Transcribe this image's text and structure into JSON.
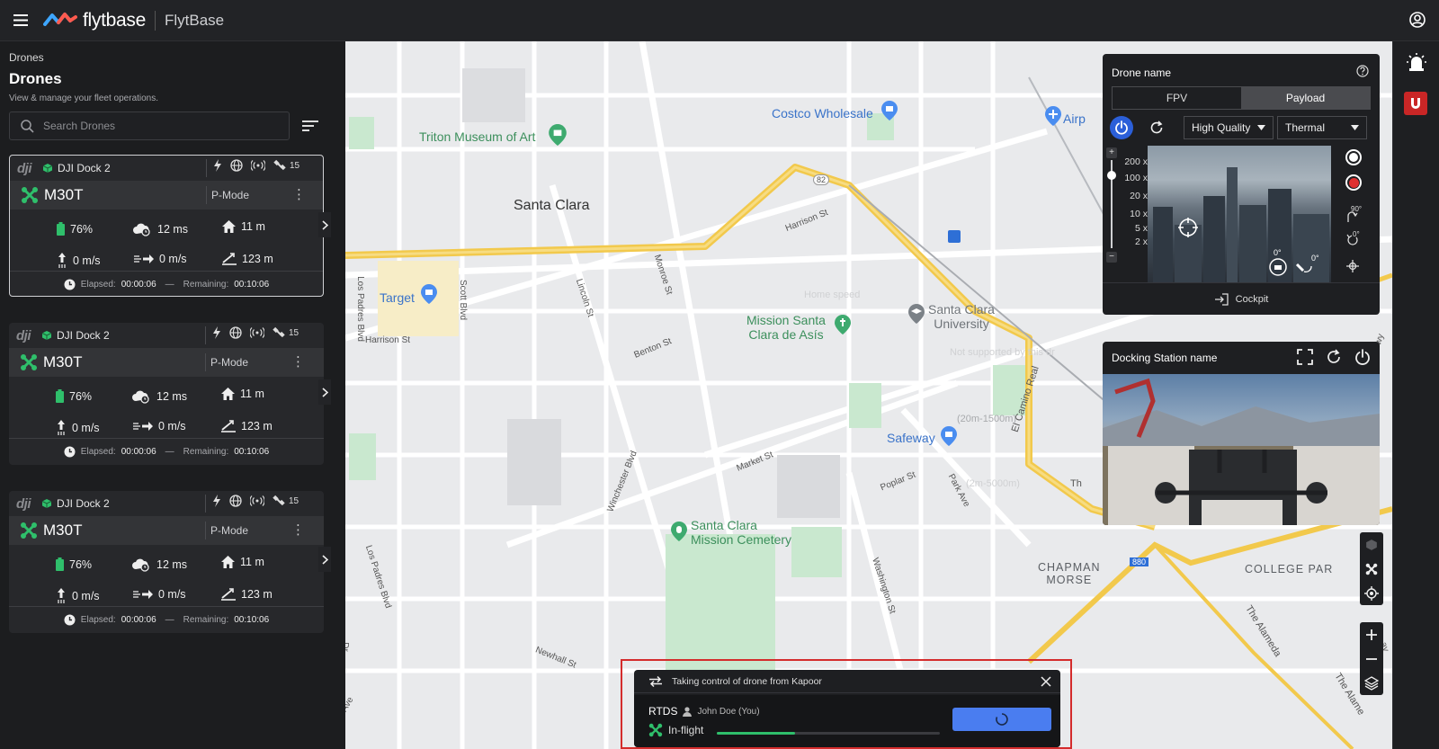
{
  "app": {
    "brand": "flytbase",
    "org": "FlytBase"
  },
  "sidebar": {
    "breadcrumb": "Drones",
    "title": "Drones",
    "subtitle": "View & manage your fleet operations.",
    "search_placeholder": "Search Drones"
  },
  "drones": [
    {
      "brand": "dji",
      "dock": "DJI Dock 2",
      "satellites": "15",
      "model": "M30T",
      "mode": "P-Mode",
      "battery": "76%",
      "latency": "12 ms",
      "home_distance": "11 m",
      "vspeed": "0 m/s",
      "hspeed": "0 m/s",
      "altitude": "123 m",
      "elapsed_label": "Elapsed:",
      "elapsed": "00:00:06",
      "sep": "—",
      "remaining_label": "Remaining:",
      "remaining": "00:10:06"
    },
    {
      "brand": "dji",
      "dock": "DJI Dock 2",
      "satellites": "15",
      "model": "M30T",
      "mode": "P-Mode",
      "battery": "76%",
      "latency": "12 ms",
      "home_distance": "11 m",
      "vspeed": "0 m/s",
      "hspeed": "0 m/s",
      "altitude": "123 m",
      "elapsed_label": "Elapsed:",
      "elapsed": "00:00:06",
      "sep": "—",
      "remaining_label": "Remaining:",
      "remaining": "00:10:06"
    },
    {
      "brand": "dji",
      "dock": "DJI Dock 2",
      "satellites": "15",
      "model": "M30T",
      "mode": "P-Mode",
      "battery": "76%",
      "latency": "12 ms",
      "home_distance": "11 m",
      "vspeed": "0 m/s",
      "hspeed": "0 m/s",
      "altitude": "123 m",
      "elapsed_label": "Elapsed:",
      "elapsed": "00:00:06",
      "sep": "—",
      "remaining_label": "Remaining:",
      "remaining": "00:10:06"
    }
  ],
  "map": {
    "labels": {
      "santa_clara": "Santa Clara",
      "costco": "Costco Wholesale",
      "triton": "Triton Museum of Art",
      "target": "Target",
      "mission": "Mission Santa\nClara de Asís",
      "scu": "Santa Clara\nUniversity",
      "safeway": "Safeway",
      "cemetery": "Santa Clara\nMission Cemetery",
      "chapman": "CHAPMAN\nMORSE",
      "college": "COLLEGE PAR",
      "airport": "Airp",
      "harrison": "Harrison St",
      "harrison2": "Harrison St",
      "monroe": "Monroe St",
      "lincoln": "Lincoln St",
      "benton": "Benton St",
      "market": "Market St",
      "poplar": "Poplar St",
      "park": "Park Ave",
      "winchester": "Winchester Blvd",
      "washington": "Washington St",
      "newhall": "Newhall St",
      "los_padres": "Los Padres Blvd",
      "los_padres2": "Los Padres Blvd",
      "scott": "Scott Blvd",
      "el_camino": "El Camino Real",
      "alameda": "The Alameda",
      "alameda2": "The Alame",
      "hwy82": "82",
      "hwy880": "880",
      "home_speed": "Home speed",
      "not_supported": "Not supported by this dr",
      "range1": "(20m-1500m)",
      "range2": "(2m-5000m)",
      "wy": "wy",
      "th": "Th",
      "ay": "ay",
      "ave": "Ave",
      "dr": "Dr"
    }
  },
  "drone_panel": {
    "title": "Drone name",
    "tabs": [
      "FPV",
      "Payload"
    ],
    "quality": "High Quality",
    "camera": "Thermal",
    "zoom_levels": [
      "200 x",
      "100 x",
      "20 x",
      "10 x",
      "5 x",
      "2 x"
    ],
    "gimbal_a": "0°",
    "gimbal_b": "0°",
    "angle_90": "90°",
    "angle_0": "0°",
    "cockpit": "Cockpit"
  },
  "dock_panel": {
    "title": "Docking Station name"
  },
  "toast": {
    "header": "Taking control of drone from Kapoor",
    "rtds": "RTDS",
    "user": "John Doe (You)",
    "status": "In-flight",
    "progress": 0.35
  },
  "colors": {
    "accent_blue": "#2b5fd9",
    "drone_green": "#2fbf6b",
    "record_red": "#e03030",
    "alert_red": "#d42c2c"
  }
}
